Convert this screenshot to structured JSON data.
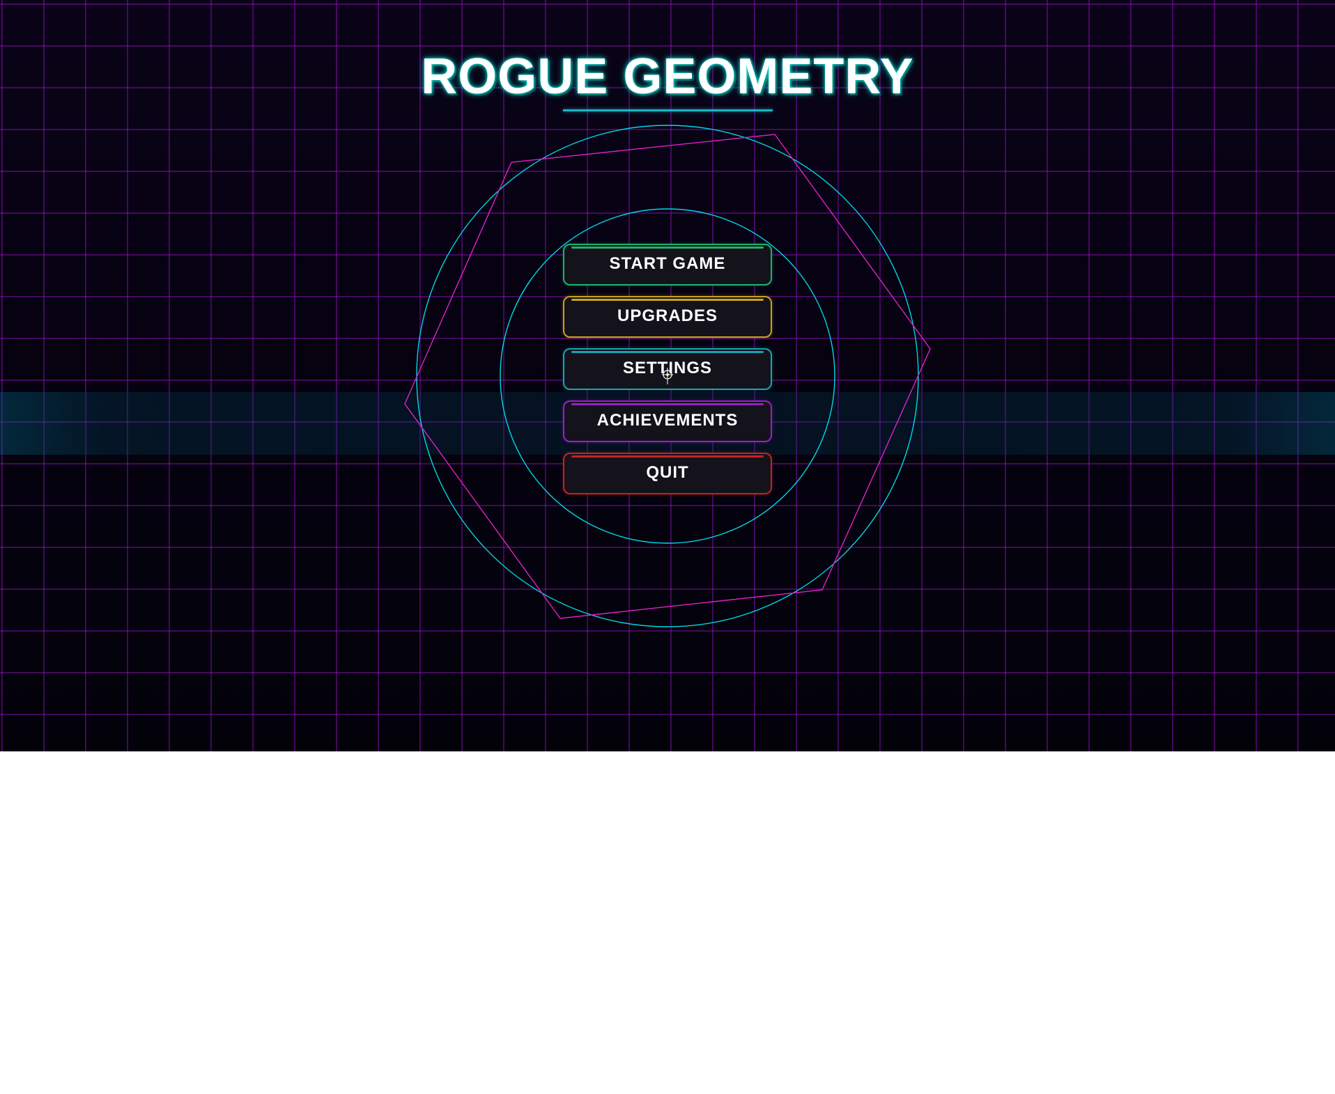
{
  "game": {
    "title": "ROGUE GEOMETRY",
    "menu": [
      {
        "id": "start",
        "label": "START GAME",
        "color": "#1db36a"
      },
      {
        "id": "upgrades",
        "label": "UPGRADES",
        "color": "#c9a21d"
      },
      {
        "id": "settings",
        "label": "SETTINGS",
        "color": "#1aa3b0"
      },
      {
        "id": "achievements",
        "label": "ACHIEVEMENTS",
        "color": "#9a1fc4"
      },
      {
        "id": "quit",
        "label": "QUIT",
        "color": "#c42222"
      }
    ],
    "colors": {
      "grid": "#9a10c8",
      "accent_cyan": "#00d8e8",
      "accent_magenta": "#e020c8",
      "background": "#05020f"
    },
    "decor": {
      "background": "neon-grid",
      "shapes": [
        "outer-circle",
        "inner-circle",
        "rotated-hexagon"
      ],
      "cursor_icon": "crosshair-icon"
    }
  }
}
